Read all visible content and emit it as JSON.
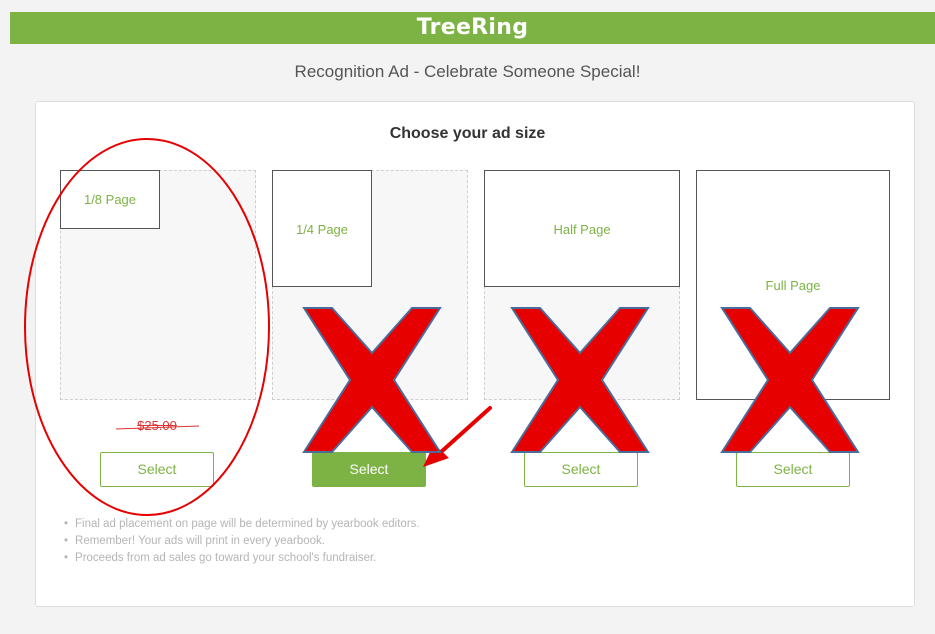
{
  "header": {
    "logo": "TreeRing",
    "brand_color": "#7db344"
  },
  "page": {
    "subtitle": "Recognition Ad - Celebrate Someone Special!"
  },
  "panel": {
    "heading": "Choose your ad size"
  },
  "options": [
    {
      "label": "1/8 Page",
      "price": "$25.00",
      "button": "Select"
    },
    {
      "label": "1/4 Page",
      "button": "Select"
    },
    {
      "label": "Half Page",
      "button": "Select"
    },
    {
      "label": "Full Page",
      "button": "Select"
    }
  ],
  "notes": [
    "Final ad placement on page will be determined by yearbook editors.",
    "Remember! Your ads will print in every yearbook.",
    "Proceeds from ad sales go toward your school's fundraiser."
  ],
  "annotations": {
    "mark_color": "#e60000",
    "x_outline_color": "#4a6c9b"
  }
}
